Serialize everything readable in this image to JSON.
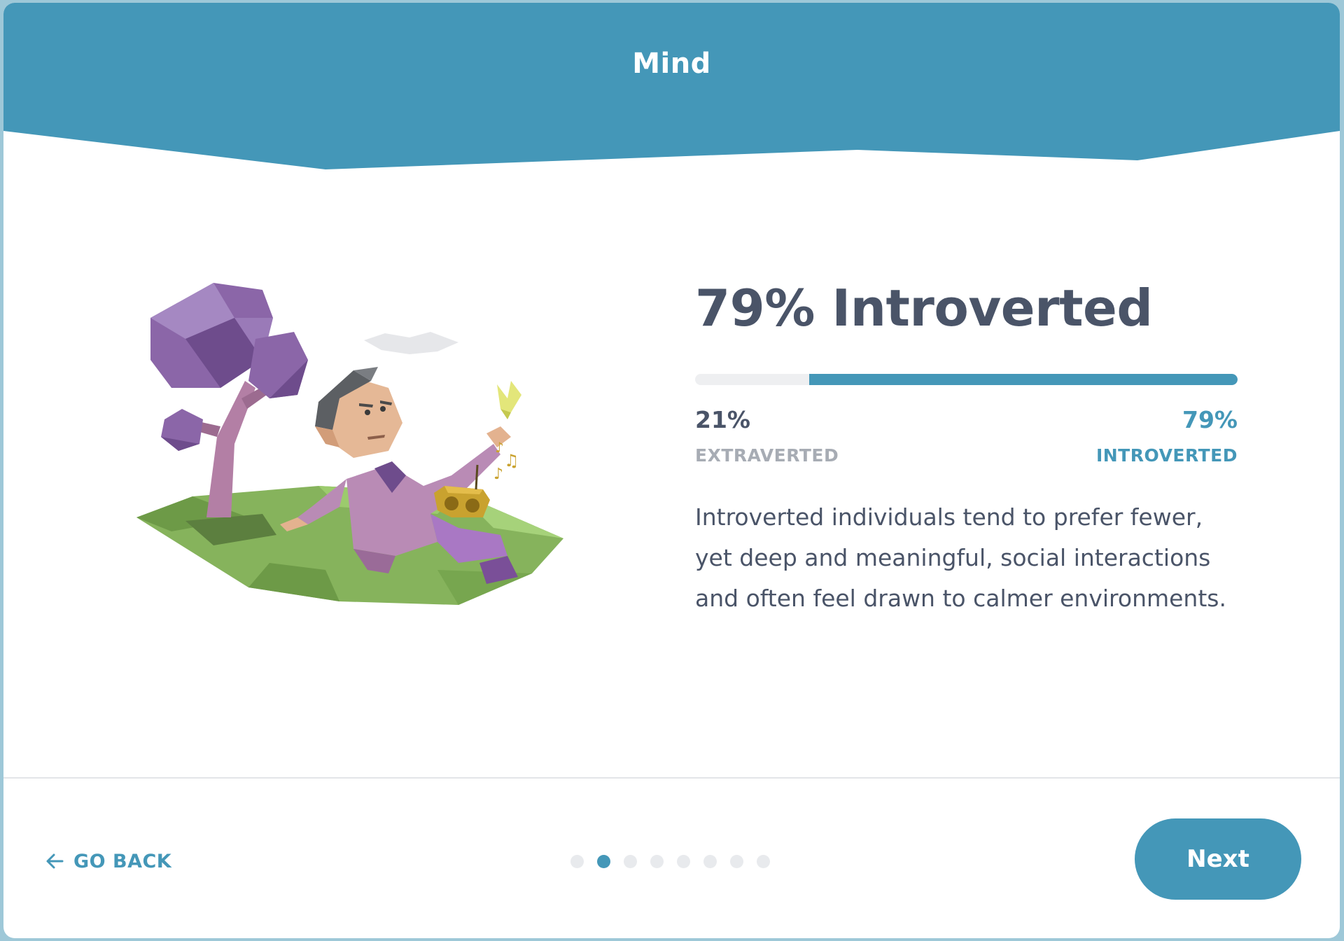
{
  "header": {
    "title": "Mind"
  },
  "result": {
    "title": "79% Introverted",
    "introverted_fraction": 0.79,
    "left_percent": "21%",
    "left_trait": "EXTRAVERTED",
    "right_percent": "79%",
    "right_trait": "INTROVERTED",
    "description": "Introverted individuals tend to prefer fewer, yet deep and meaningful, social interactions and often feel drawn to calmer environments."
  },
  "footer": {
    "back_label": "GO BACK",
    "next_label": "Next",
    "steps_total": 8,
    "current_step": 2
  },
  "colors": {
    "accent": "#4497b8",
    "heading": "#4a5468",
    "muted": "#a7acb4"
  },
  "icons": {
    "back": "arrow-left-icon",
    "illustration": "introvert-man-under-tree-illustration"
  }
}
